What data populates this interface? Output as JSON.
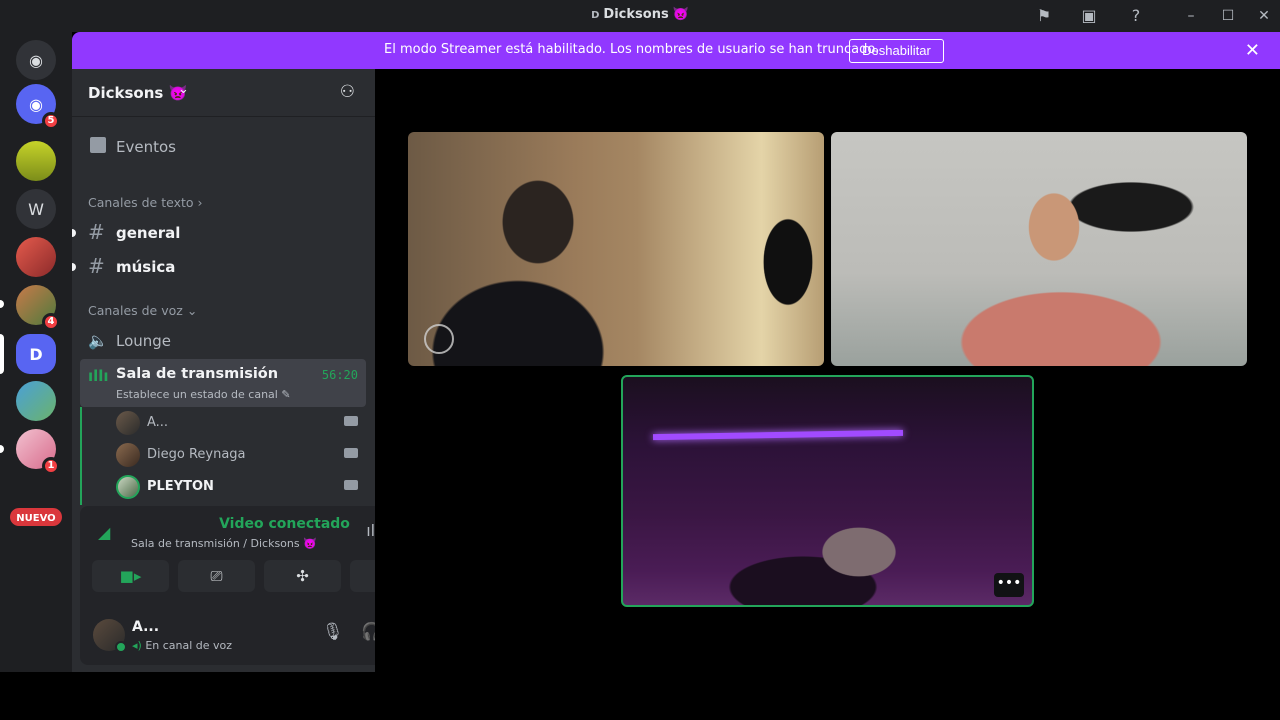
{
  "window": {
    "title": "Dicksons",
    "title_logo": "D",
    "title_emoji": "👿"
  },
  "rail": {
    "home_badge": "5",
    "server_w_label": "W",
    "server_4_badge": "4",
    "server_d_label": "D",
    "server_pink_badge": "1",
    "new_label": "NUEVO"
  },
  "banner": {
    "text": "El modo Streamer está habilitado. Los nombres de usuario se han truncado.",
    "button": "Deshabilitar"
  },
  "guild": {
    "name": "Dicksons",
    "emoji": "👿",
    "events": "Eventos",
    "text_category": "Canales de texto",
    "text_channels": [
      "general",
      "música"
    ],
    "voice_category": "Canales de voz",
    "voice_channels": [
      "Lounge"
    ],
    "stage": {
      "name": "Sala de transmisión",
      "time": "56:20",
      "status": "Establece un estado de canal"
    },
    "members": [
      "A...",
      "Diego Reynaga",
      "PLEYTON"
    ]
  },
  "voice": {
    "title": "Video conectado",
    "subtitle": "Sala de transmisión / Dicksons",
    "emoji": "👿"
  },
  "user": {
    "name": "A...",
    "status": "En canal de voz"
  },
  "icons": {
    "flag": "flag-icon",
    "inbox": "inbox-icon",
    "help": "help-icon"
  },
  "colors": {
    "banner": "#9138ff",
    "connected": "#23a55a",
    "mention": "#f23f43"
  }
}
